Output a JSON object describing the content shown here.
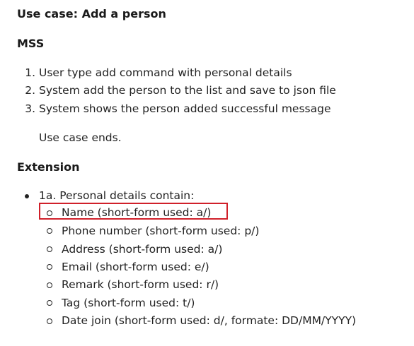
{
  "title": "Use case: Add a person",
  "mss": {
    "heading": "MSS",
    "steps": [
      {
        "num": "1.",
        "text": "User type add command with personal details"
      },
      {
        "num": "2.",
        "text": "System add the person to the list and save to json file"
      },
      {
        "num": "3.",
        "text": "System shows the person added successful message"
      }
    ],
    "end": "Use case ends."
  },
  "extension": {
    "heading": "Extension",
    "item": "1a. Personal details contain:",
    "subitems": [
      "Name (short-form used: a/)",
      "Phone number (short-form used: p/)",
      "Address (short-form used: a/)",
      "Email (short-form used: e/)",
      "Remark (short-form used: r/)",
      "Tag (short-form used: t/)",
      "Date join (short-form used: d/, formate: DD/MM/YYYY)"
    ]
  },
  "colors": {
    "highlight_border": "#d0202a"
  }
}
